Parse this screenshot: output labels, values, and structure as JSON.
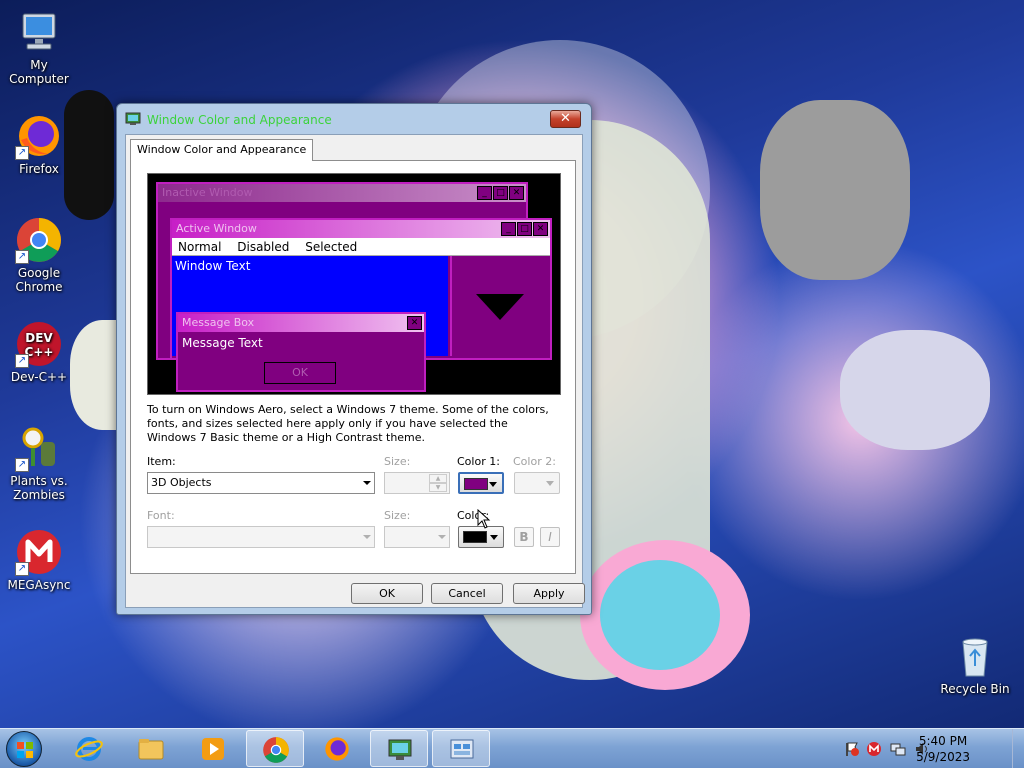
{
  "desktop": {
    "icons": [
      {
        "label": "My Computer"
      },
      {
        "label": "Firefox"
      },
      {
        "label": "Google Chrome"
      },
      {
        "label": "Dev-C++"
      },
      {
        "label": "Plants vs. Zombies"
      },
      {
        "label": "MEGAsync"
      },
      {
        "label": "Recycle Bin"
      }
    ],
    "devcpp_badge": "DEV\nC++"
  },
  "dialog": {
    "title": "Window Color and Appearance",
    "close_glyph": "✕",
    "tab_label": "Window Color and Appearance",
    "preview": {
      "inactive_title": "Inactive Window",
      "active_title": "Active Window",
      "menu_normal": "Normal",
      "menu_disabled": "Disabled",
      "menu_selected": "Selected",
      "window_text": "Window Text",
      "message_box_title": "Message Box",
      "message_text": "Message Text",
      "ok_label": "OK"
    },
    "description": "To turn on Windows Aero, select a Windows 7 theme.  Some of the colors, fonts, and sizes selected here apply only if you have selected the Windows 7 Basic theme or a High Contrast theme.",
    "item_label": "Item:",
    "item_value": "3D Objects",
    "size_label": "Size:",
    "color1_label": "Color 1:",
    "color2_label": "Color 2:",
    "font_label": "Font:",
    "font_size_label": "Size:",
    "font_color_label": "Color:",
    "bold_label": "B",
    "italic_label": "I",
    "ok_button": "OK",
    "cancel_button": "Cancel",
    "apply_button": "Apply",
    "colors": {
      "color1": "#800080",
      "font_color": "#000000",
      "window_background": "#0000ff",
      "preview_frame": "#800080",
      "active_title_gradient_start": "#c71fc7",
      "inactive_title_gradient_start": "#8d2a8d"
    }
  },
  "taskbar": {
    "time": "5:40 PM",
    "date": "5/9/2023",
    "items": [
      "start",
      "internet-explorer",
      "file-explorer",
      "media-player",
      "chrome",
      "firefox",
      "display-settings",
      "control-panel"
    ]
  }
}
